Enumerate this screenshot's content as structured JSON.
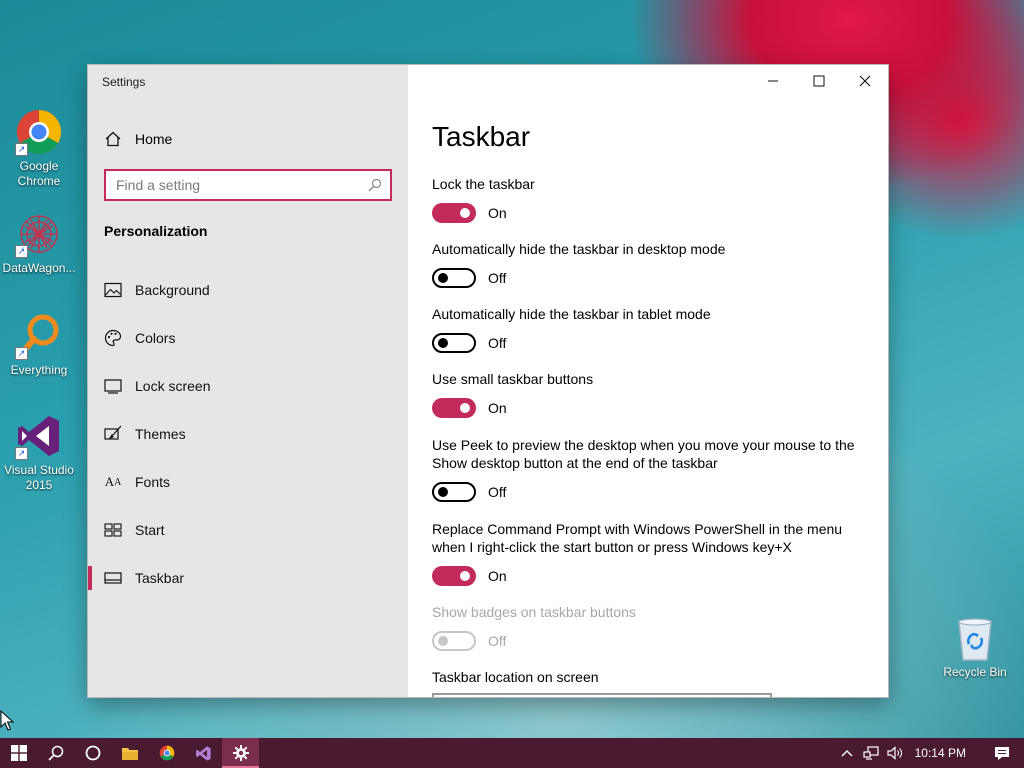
{
  "desktop": {
    "icons": [
      {
        "label": "Google\nChrome",
        "icon": "chrome-icon"
      },
      {
        "label": "DataWagon...",
        "icon": "datawagon-icon"
      },
      {
        "label": "Everything",
        "icon": "everything-icon"
      },
      {
        "label": "Visual Studio\n2015",
        "icon": "visual-studio-icon"
      },
      {
        "label": "Recycle Bin",
        "icon": "recycle-bin-icon"
      }
    ]
  },
  "window": {
    "title": "Settings",
    "controls": [
      "minimize",
      "maximize",
      "close"
    ]
  },
  "sidebar": {
    "home_label": "Home",
    "search_placeholder": "Find a setting",
    "search_value": "",
    "section_title": "Personalization",
    "items": [
      {
        "label": "Background",
        "icon": "picture-icon",
        "selected": false
      },
      {
        "label": "Colors",
        "icon": "palette-icon",
        "selected": false
      },
      {
        "label": "Lock screen",
        "icon": "monitor-icon",
        "selected": false
      },
      {
        "label": "Themes",
        "icon": "brush-icon",
        "selected": false
      },
      {
        "label": "Fonts",
        "icon": "font-icon",
        "selected": false
      },
      {
        "label": "Start",
        "icon": "start-layout-icon",
        "selected": false
      },
      {
        "label": "Taskbar",
        "icon": "taskbar-icon",
        "selected": true
      }
    ]
  },
  "content": {
    "page_title": "Taskbar",
    "settings": [
      {
        "label": "Lock the taskbar",
        "state": "On",
        "on": true,
        "disabled": false
      },
      {
        "label": "Automatically hide the taskbar in desktop mode",
        "state": "Off",
        "on": false,
        "disabled": false
      },
      {
        "label": "Automatically hide the taskbar in tablet mode",
        "state": "Off",
        "on": false,
        "disabled": false
      },
      {
        "label": "Use small taskbar buttons",
        "state": "On",
        "on": true,
        "disabled": false
      },
      {
        "label": "Use Peek to preview the desktop when you move your mouse to the Show desktop button at the end of the taskbar",
        "state": "Off",
        "on": false,
        "disabled": false
      },
      {
        "label": "Replace Command Prompt with Windows PowerShell in the menu when I right-click the start button or press Windows key+X",
        "state": "On",
        "on": true,
        "disabled": false
      },
      {
        "label": "Show badges on taskbar buttons",
        "state": "Off",
        "on": false,
        "disabled": true
      }
    ],
    "location_label": "Taskbar location on screen"
  },
  "taskbar": {
    "buttons": [
      "start-icon",
      "search-icon",
      "cortana-icon",
      "file-explorer-icon",
      "chrome-icon",
      "visual-studio-icon",
      "settings-icon"
    ],
    "active": "settings-icon",
    "clock": "10:14 PM"
  },
  "colors": {
    "accent": "#c32b5b",
    "taskbar": "#4a1a30",
    "sidebar": "#e6e6e6"
  }
}
